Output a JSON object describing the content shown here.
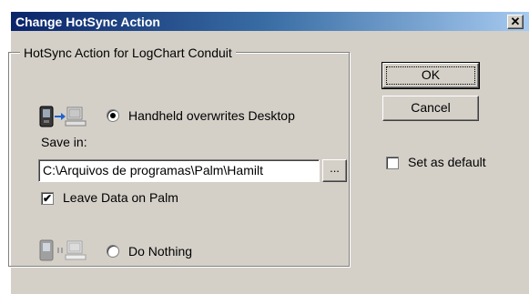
{
  "window": {
    "title": "Change HotSync Action",
    "close_glyph": "✕"
  },
  "group": {
    "legend": "HotSync Action for LogChart Conduit",
    "options": [
      {
        "label": "Handheld overwrites Desktop",
        "selected": true,
        "icon": "handheld-to-desktop-icon"
      },
      {
        "label": "Do Nothing",
        "selected": false,
        "icon": "do-nothing-icon"
      }
    ],
    "save_in_label": "Save in:",
    "save_in_value": "C:\\Arquivos de programas\\Palm\\Hamilt",
    "browse_label": "...",
    "leave_data": {
      "label": "Leave Data on Palm",
      "checked": true
    }
  },
  "buttons": {
    "ok": "OK",
    "cancel": "Cancel"
  },
  "set_default": {
    "label": "Set as default",
    "checked": false
  },
  "colors": {
    "title_start": "#0a246a",
    "title_end": "#a6caf0",
    "face": "#d4d0c8",
    "arrow_blue": "#1e62d0"
  }
}
